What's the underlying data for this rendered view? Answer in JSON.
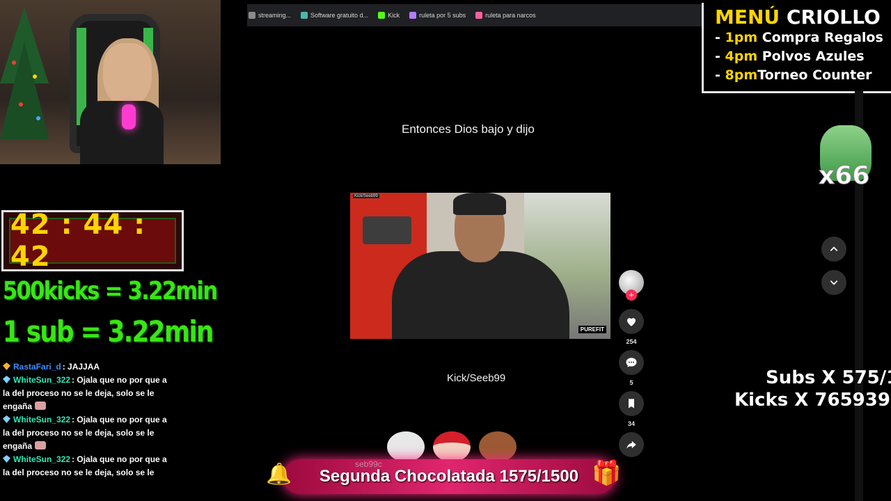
{
  "browser": {
    "bookmarks": [
      {
        "label": "streaming...",
        "icon": "bookmark-folder-icon",
        "color": "#8a8a8a"
      },
      {
        "label": "Software gratuito d...",
        "icon": "software-site-icon",
        "color": "#4db6ac"
      },
      {
        "label": "Kick",
        "icon": "kick-logo-icon",
        "color": "#53fc18"
      },
      {
        "label": "ruleta por 5 subs",
        "icon": "wheel-icon",
        "color": "#b57cff"
      },
      {
        "label": "ruleta para narcos",
        "icon": "wheel-icon",
        "color": "#ff5fa2"
      }
    ]
  },
  "timer": {
    "value": "42 : 44 : 42"
  },
  "rules": {
    "kicks": "500kicks = 3.22min",
    "sub": "1 sub = 3.22min"
  },
  "chat": [
    {
      "user": "RastaFari_d",
      "user_color": "#3d8bff",
      "badge_color": "#f0b429",
      "text": ": JAJJAA",
      "emote": false
    },
    {
      "user": "WhiteSun_322",
      "user_color": "#2ee8b5",
      "badge_color": "#7fd3ff",
      "text": ": Ojala que no por que a la del proceso no se le deja, solo se le engaña",
      "emote": true
    },
    {
      "user": "WhiteSun_322",
      "user_color": "#2ee8b5",
      "badge_color": "#7fd3ff",
      "text": ": Ojala que no por que a la del proceso no se le deja, solo se le engaña",
      "emote": true
    },
    {
      "user": "WhiteSun_322",
      "user_color": "#2ee8b5",
      "badge_color": "#7fd3ff",
      "text": ": Ojala que no por que a la del proceso no se le deja, solo se le",
      "emote": false
    }
  ],
  "video": {
    "caption": "Entonces Dios bajo y dijo",
    "handle": "Kick/Seeb99",
    "watermark": "PUREFIT"
  },
  "actions": {
    "follow": "+",
    "like_count": "254",
    "comment_count": "5",
    "save_count": "34"
  },
  "menu": {
    "title_a": "MENÚ",
    "title_b": "CRIOLLO",
    "items": [
      {
        "time": "1pm",
        "label": "Compra Regalos"
      },
      {
        "time": "4pm",
        "label": "Polvos Azules"
      },
      {
        "time": "8pm",
        "label": "Torneo Counter"
      }
    ]
  },
  "frog": {
    "count": "x66"
  },
  "stats": {
    "subs": "Subs X 575/1",
    "kicks": "Kicks X 765939"
  },
  "goal": {
    "label": "Segunda Chocolatada 1575/1500",
    "under": "seb99c"
  }
}
